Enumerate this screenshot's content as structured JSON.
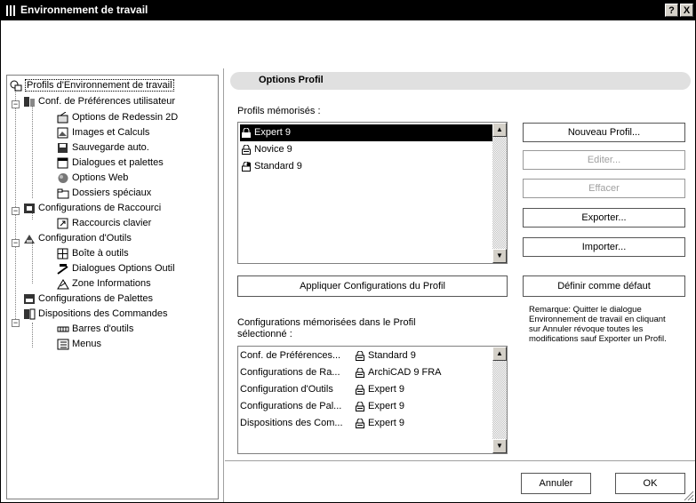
{
  "window": {
    "title": "Environnement de travail",
    "help_label": "?",
    "close_label": "X"
  },
  "sidebar": {
    "items": [
      {
        "label": "Profils d'Environnement de travail",
        "icon": "profiles-icon"
      },
      {
        "label": "Conf. de Préférences utilisateur",
        "icon": "preferences-icon"
      },
      {
        "label": "Options de Redessin 2D",
        "icon": "redraw-icon"
      },
      {
        "label": "Images et Calculs",
        "icon": "images-icon"
      },
      {
        "label": "Sauvegarde auto.",
        "icon": "autosave-icon"
      },
      {
        "label": "Dialogues et palettes",
        "icon": "dialogs-icon"
      },
      {
        "label": "Options Web",
        "icon": "web-icon"
      },
      {
        "label": "Dossiers spéciaux",
        "icon": "folders-icon"
      },
      {
        "label": "Configurations de Raccourci",
        "icon": "shortcuts-config-icon"
      },
      {
        "label": "Raccourcis clavier",
        "icon": "keyboard-icon"
      },
      {
        "label": "Configuration d'Outils",
        "icon": "tools-config-icon"
      },
      {
        "label": "Boîte à outils",
        "icon": "toolbox-icon"
      },
      {
        "label": "Dialogues Options Outil",
        "icon": "tool-options-icon"
      },
      {
        "label": "Zone Informations",
        "icon": "info-zone-icon"
      },
      {
        "label": "Configurations de Palettes",
        "icon": "palettes-icon"
      },
      {
        "label": "Dispositions des Commandes",
        "icon": "commands-icon"
      },
      {
        "label": "Barres d'outils",
        "icon": "toolbars-icon"
      },
      {
        "label": "Menus",
        "icon": "menus-icon"
      }
    ]
  },
  "panel": {
    "title": "Options Profil",
    "profiles_label": "Profils mémorisés :",
    "profiles": [
      "Expert 9",
      "Novice 9",
      "Standard 9"
    ],
    "buttons": {
      "new_profile": "Nouveau Profil...",
      "edit": "Editer...",
      "delete": "Effacer",
      "export": "Exporter...",
      "import": "Importer...",
      "apply": "Appliquer Configurations du Profil",
      "set_default": "Définir comme défaut"
    },
    "configs_label_line1": "Configurations mémorisées dans le Profil",
    "configs_label_line2": "sélectionné :",
    "configs": [
      {
        "name": "Conf. de Préférences...",
        "profile": "Standard 9"
      },
      {
        "name": "Configurations de Ra...",
        "profile": "ArchiCAD 9 FRA"
      },
      {
        "name": "Configuration d'Outils",
        "profile": "Expert 9"
      },
      {
        "name": "Configurations de Pal...",
        "profile": "Expert 9"
      },
      {
        "name": "Dispositions des Com...",
        "profile": "Expert 9"
      }
    ],
    "note": "Remarque: Quitter le dialogue Environnement de travail en cliquant sur Annuler révoque toutes les modifications sauf Exporter un Profil."
  },
  "footer": {
    "cancel": "Annuler",
    "ok": "OK"
  }
}
